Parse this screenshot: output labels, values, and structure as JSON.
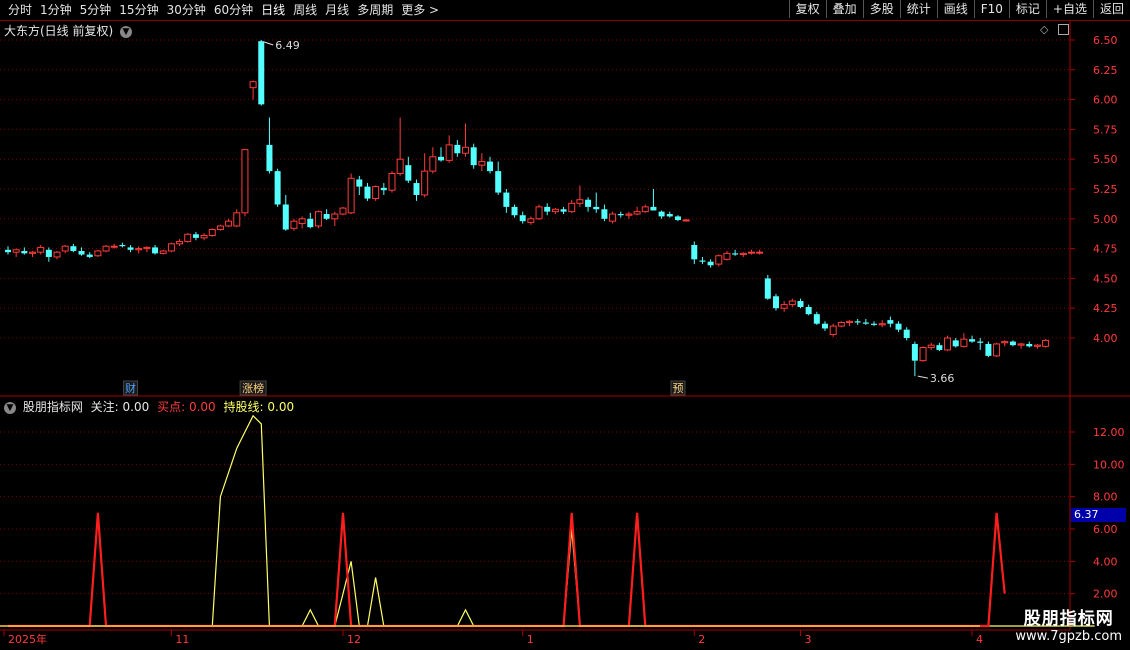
{
  "toolbar": {
    "tabs": [
      {
        "label": "分时",
        "active": false
      },
      {
        "label": "1分钟",
        "active": false
      },
      {
        "label": "5分钟",
        "active": false
      },
      {
        "label": "15分钟",
        "active": false
      },
      {
        "label": "30分钟",
        "active": false
      },
      {
        "label": "60分钟",
        "active": false
      },
      {
        "label": "日线",
        "active": true
      },
      {
        "label": "周线",
        "active": false
      },
      {
        "label": "月线",
        "active": false
      },
      {
        "label": "多周期",
        "active": false
      },
      {
        "label": "更多 >",
        "active": false
      }
    ],
    "buttons": [
      "复权",
      "叠加",
      "多股",
      "统计",
      "画线",
      "F10",
      "标记",
      "+自选",
      "返回"
    ]
  },
  "main_panel": {
    "title": "大东方(日线 前复权)",
    "high_label": "6.49",
    "low_label": "3.66",
    "markers": [
      {
        "label": "财",
        "bar": 15,
        "color": "#4da3ff"
      },
      {
        "label": "涨榜",
        "bar": 30,
        "color": "#ffd27f"
      },
      {
        "label": "预",
        "bar": 82,
        "color": "#ffd27f"
      }
    ],
    "y_ticks": [
      "6.50",
      "6.25",
      "6.00",
      "5.75",
      "5.50",
      "5.25",
      "5.00",
      "4.75",
      "4.50",
      "4.25",
      "4.00"
    ]
  },
  "indicator_panel": {
    "name": "股朋指标网",
    "label1": "关注:",
    "value1": "0.00",
    "label2": "买点:",
    "value2": "0.00",
    "label3": "持股线:",
    "value3": "0.00",
    "y_ticks": [
      "12.00",
      "10.00",
      "8.00",
      "6.00",
      "4.00",
      "2.00"
    ],
    "price_tag": "6.37"
  },
  "time_axis": [
    "2025年",
    "11",
    "12",
    "1",
    "2",
    "3",
    "4"
  ],
  "watermark": {
    "title": "股朋指标网",
    "url": "www.7gpzb.com"
  },
  "colors": {
    "up": "#ff3b3b",
    "down": "#54ffff",
    "red_line": "#ff1e1e",
    "yellow_line": "#ffff66",
    "grid": "#7a0000"
  },
  "chart_data": [
    {
      "type": "candlestick",
      "title": "大东方(日线 前复权)",
      "ylim": [
        3.5,
        6.6
      ],
      "ohlc": [
        [
          4.74,
          4.77,
          4.7,
          4.72
        ],
        [
          4.72,
          4.75,
          4.68,
          4.74
        ],
        [
          4.73,
          4.76,
          4.7,
          4.71
        ],
        [
          4.71,
          4.73,
          4.68,
          4.72
        ],
        [
          4.72,
          4.78,
          4.7,
          4.76
        ],
        [
          4.74,
          4.76,
          4.64,
          4.68
        ],
        [
          4.68,
          4.73,
          4.66,
          4.72
        ],
        [
          4.73,
          4.78,
          4.71,
          4.77
        ],
        [
          4.77,
          4.79,
          4.72,
          4.73
        ],
        [
          4.73,
          4.76,
          4.69,
          4.7
        ],
        [
          4.7,
          4.72,
          4.67,
          4.68
        ],
        [
          4.69,
          4.74,
          4.68,
          4.73
        ],
        [
          4.73,
          4.78,
          4.72,
          4.77
        ],
        [
          4.77,
          4.79,
          4.75,
          4.77
        ],
        [
          4.78,
          4.8,
          4.76,
          4.77
        ],
        [
          4.76,
          4.78,
          4.72,
          4.74
        ],
        [
          4.74,
          4.77,
          4.71,
          4.75
        ],
        [
          4.75,
          4.77,
          4.72,
          4.76
        ],
        [
          4.76,
          4.78,
          4.7,
          4.71
        ],
        [
          4.71,
          4.74,
          4.7,
          4.73
        ],
        [
          4.73,
          4.8,
          4.72,
          4.79
        ],
        [
          4.79,
          4.83,
          4.77,
          4.81
        ],
        [
          4.81,
          4.88,
          4.8,
          4.87
        ],
        [
          4.87,
          4.89,
          4.82,
          4.84
        ],
        [
          4.84,
          4.88,
          4.82,
          4.86
        ],
        [
          4.86,
          4.92,
          4.85,
          4.91
        ],
        [
          4.91,
          4.95,
          4.9,
          4.94
        ],
        [
          4.94,
          5.0,
          4.93,
          4.98
        ],
        [
          4.94,
          5.08,
          4.93,
          5.05
        ],
        [
          5.05,
          5.58,
          5.02,
          5.58
        ],
        [
          6.1,
          6.16,
          6.0,
          6.15
        ],
        [
          6.49,
          6.5,
          5.95,
          5.96
        ],
        [
          5.62,
          5.85,
          5.38,
          5.4
        ],
        [
          5.4,
          5.42,
          5.1,
          5.12
        ],
        [
          5.12,
          5.2,
          4.9,
          4.91
        ],
        [
          4.92,
          5.0,
          4.9,
          4.98
        ],
        [
          4.96,
          5.02,
          4.92,
          5.0
        ],
        [
          5.0,
          5.05,
          4.92,
          4.93
        ],
        [
          4.94,
          5.07,
          4.92,
          5.06
        ],
        [
          5.04,
          5.08,
          4.99,
          5.0
        ],
        [
          5.0,
          5.06,
          4.94,
          5.04
        ],
        [
          5.04,
          5.1,
          5.03,
          5.09
        ],
        [
          5.05,
          5.38,
          5.04,
          5.34
        ],
        [
          5.33,
          5.36,
          5.2,
          5.27
        ],
        [
          5.27,
          5.3,
          5.15,
          5.17
        ],
        [
          5.17,
          5.28,
          5.15,
          5.27
        ],
        [
          5.26,
          5.3,
          5.2,
          5.24
        ],
        [
          5.24,
          5.4,
          5.22,
          5.38
        ],
        [
          5.38,
          5.85,
          5.36,
          5.5
        ],
        [
          5.45,
          5.52,
          5.3,
          5.32
        ],
        [
          5.3,
          5.33,
          5.15,
          5.2
        ],
        [
          5.2,
          5.55,
          5.18,
          5.4
        ],
        [
          5.4,
          5.6,
          5.38,
          5.52
        ],
        [
          5.52,
          5.6,
          5.48,
          5.49
        ],
        [
          5.49,
          5.7,
          5.47,
          5.62
        ],
        [
          5.62,
          5.66,
          5.52,
          5.55
        ],
        [
          5.55,
          5.8,
          5.52,
          5.6
        ],
        [
          5.6,
          5.63,
          5.42,
          5.45
        ],
        [
          5.45,
          5.55,
          5.4,
          5.48
        ],
        [
          5.48,
          5.52,
          5.38,
          5.4
        ],
        [
          5.4,
          5.48,
          5.2,
          5.22
        ],
        [
          5.22,
          5.25,
          5.05,
          5.1
        ],
        [
          5.1,
          5.12,
          5.01,
          5.03
        ],
        [
          5.03,
          5.06,
          4.96,
          4.98
        ],
        [
          4.97,
          5.02,
          4.95,
          5.0
        ],
        [
          5.0,
          5.12,
          4.99,
          5.1
        ],
        [
          5.1,
          5.13,
          5.03,
          5.06
        ],
        [
          5.06,
          5.09,
          5.04,
          5.08
        ],
        [
          5.08,
          5.1,
          5.04,
          5.06
        ],
        [
          5.06,
          5.16,
          5.05,
          5.13
        ],
        [
          5.13,
          5.28,
          5.1,
          5.16
        ],
        [
          5.16,
          5.18,
          5.06,
          5.1
        ],
        [
          5.1,
          5.22,
          5.05,
          5.08
        ],
        [
          5.08,
          5.12,
          4.98,
          5.0
        ],
        [
          4.98,
          5.06,
          4.96,
          5.04
        ],
        [
          5.04,
          5.06,
          5.01,
          5.03
        ],
        [
          5.03,
          5.06,
          5.0,
          5.04
        ],
        [
          5.04,
          5.1,
          5.03,
          5.06
        ],
        [
          5.06,
          5.12,
          5.05,
          5.1
        ],
        [
          5.1,
          5.25,
          5.08,
          5.07
        ],
        [
          5.06,
          5.07,
          5.0,
          5.02
        ],
        [
          5.04,
          5.06,
          5.01,
          5.02
        ],
        [
          5.02,
          5.03,
          4.98,
          4.99
        ],
        [
          4.99,
          5.0,
          4.98,
          4.99
        ],
        [
          4.78,
          4.81,
          4.62,
          4.66
        ],
        [
          4.65,
          4.68,
          4.62,
          4.64
        ],
        [
          4.64,
          4.66,
          4.59,
          4.61
        ],
        [
          4.62,
          4.7,
          4.6,
          4.69
        ],
        [
          4.66,
          4.73,
          4.65,
          4.71
        ],
        [
          4.71,
          4.74,
          4.69,
          4.7
        ],
        [
          4.7,
          4.72,
          4.68,
          4.71
        ],
        [
          4.72,
          4.74,
          4.7,
          4.72
        ],
        [
          4.72,
          4.74,
          4.7,
          4.72
        ],
        [
          4.5,
          4.53,
          4.32,
          4.33
        ],
        [
          4.35,
          4.37,
          4.23,
          4.25
        ],
        [
          4.25,
          4.31,
          4.22,
          4.28
        ],
        [
          4.28,
          4.33,
          4.26,
          4.31
        ],
        [
          4.31,
          4.33,
          4.25,
          4.26
        ],
        [
          4.26,
          4.28,
          4.19,
          4.2
        ],
        [
          4.2,
          4.22,
          4.11,
          4.12
        ],
        [
          4.12,
          4.14,
          4.06,
          4.08
        ],
        [
          4.03,
          4.12,
          4.01,
          4.1
        ],
        [
          4.1,
          4.14,
          4.09,
          4.13
        ],
        [
          4.13,
          4.15,
          4.1,
          4.14
        ],
        [
          4.14,
          4.16,
          4.11,
          4.13
        ],
        [
          4.13,
          4.16,
          4.11,
          4.12
        ],
        [
          4.12,
          4.14,
          4.1,
          4.11
        ],
        [
          4.11,
          4.15,
          4.09,
          4.12
        ],
        [
          4.15,
          4.18,
          4.09,
          4.12
        ],
        [
          4.12,
          4.14,
          4.05,
          4.07
        ],
        [
          4.07,
          4.09,
          3.98,
          4.0
        ],
        [
          3.95,
          3.97,
          3.68,
          3.81
        ],
        [
          3.81,
          3.93,
          3.8,
          3.92
        ],
        [
          3.92,
          3.96,
          3.9,
          3.94
        ],
        [
          3.94,
          3.96,
          3.89,
          3.9
        ],
        [
          3.9,
          4.02,
          3.89,
          4.0
        ],
        [
          3.98,
          4.0,
          3.92,
          3.93
        ],
        [
          3.93,
          4.04,
          3.92,
          3.99
        ],
        [
          3.99,
          4.02,
          3.96,
          3.97
        ],
        [
          3.97,
          4.0,
          3.9,
          3.96
        ],
        [
          3.95,
          3.97,
          3.84,
          3.85
        ],
        [
          3.85,
          3.96,
          3.84,
          3.95
        ],
        [
          3.96,
          3.98,
          3.93,
          3.97
        ],
        [
          3.97,
          3.98,
          3.93,
          3.94
        ],
        [
          3.94,
          3.96,
          3.91,
          3.95
        ],
        [
          3.95,
          3.97,
          3.92,
          3.93
        ],
        [
          3.93,
          3.95,
          3.91,
          3.94
        ],
        [
          3.93,
          3.99,
          3.92,
          3.98
        ]
      ]
    },
    {
      "type": "line",
      "title": "股朋指标网",
      "ylim": [
        0,
        14
      ],
      "series": [
        {
          "name": "持股线",
          "color": "#ffff66",
          "values": [
            0,
            0,
            0,
            0,
            0,
            0,
            0,
            0,
            0,
            0,
            0,
            0,
            0,
            0,
            0,
            0,
            0,
            0,
            0,
            0,
            0,
            0,
            0,
            0,
            0,
            0,
            8,
            9.5,
            11,
            12,
            13,
            12.5,
            0,
            0,
            0,
            0,
            0,
            1,
            0,
            0,
            0,
            2,
            4,
            0,
            0,
            3,
            0,
            0,
            0,
            0,
            0,
            0,
            0,
            0,
            0,
            0,
            1,
            0,
            0,
            0,
            0,
            0,
            0,
            0,
            0,
            0,
            0,
            0,
            0,
            6,
            0,
            0,
            0,
            0,
            0,
            0,
            0,
            0,
            0,
            0,
            0,
            0,
            0,
            0,
            0,
            0,
            0,
            0,
            0,
            0,
            0,
            0,
            0,
            0,
            0,
            0,
            0,
            0,
            0,
            0,
            0,
            0,
            0,
            0,
            0,
            0,
            0,
            0,
            0,
            0,
            0,
            0,
            0,
            0,
            0,
            0,
            0,
            0,
            0,
            0,
            0,
            0,
            0,
            0,
            0,
            0,
            0,
            0,
            0,
            0,
            0,
            0,
            0,
            0
          ]
        },
        {
          "name": "买点",
          "color": "#ff1e1e",
          "values": [
            0,
            0,
            0,
            0,
            0,
            0,
            0,
            0,
            0,
            0,
            0,
            7,
            0,
            0,
            0,
            0,
            0,
            0,
            0,
            0,
            0,
            0,
            0,
            0,
            0,
            0,
            0,
            0,
            0,
            0,
            0,
            0,
            0,
            0,
            0,
            0,
            0,
            0,
            0,
            0,
            0,
            7,
            0,
            0,
            0,
            0,
            0,
            0,
            0,
            0,
            0,
            0,
            0,
            0,
            0,
            0,
            0,
            0,
            0,
            0,
            0,
            0,
            0,
            0,
            0,
            0,
            0,
            0,
            0,
            7,
            0,
            0,
            0,
            0,
            0,
            0,
            0,
            7,
            0,
            0,
            0,
            0,
            0,
            0,
            0,
            0,
            0,
            0,
            0,
            0,
            0,
            0,
            0,
            0,
            0,
            0,
            0,
            0,
            0,
            0,
            0,
            0,
            0,
            0,
            0,
            0,
            0,
            0,
            0,
            0,
            0,
            0,
            0,
            0,
            0,
            0,
            0,
            0,
            0,
            0,
            0,
            7,
            2
          ]
        }
      ]
    }
  ]
}
